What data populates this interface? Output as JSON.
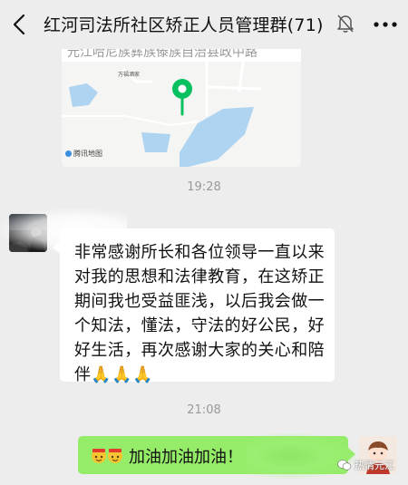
{
  "header": {
    "title": "红河司法所社区矫正人员管理群(71)",
    "back_icon": "chevron-left-icon",
    "mute_icon": "bell-off-icon",
    "more_icon": "more-icon"
  },
  "map": {
    "address": "元江哈尼族彝族傣族自治县政中路",
    "place_label": "万福酒家",
    "credit": "腾讯地图",
    "pin_color": "#07c160",
    "water_color": "#aed4f2"
  },
  "messages": [
    {
      "time": "19:28"
    },
    {
      "text": "非常感谢所长和各位领导一直以来对我的思想和法律教育，在这矫正期间我也受益匪浅，以后我会做一个知法，懂法，守法的好公民，好好生活，再次感谢大家的关心和陪伴🙏🙏🙏"
    },
    {
      "time": "21:08"
    },
    {
      "text": "加油加油加油！"
    }
  ],
  "watermark": "热情元江",
  "colors": {
    "outgoing_bubble": "#95ec69",
    "background": "#ededed"
  }
}
